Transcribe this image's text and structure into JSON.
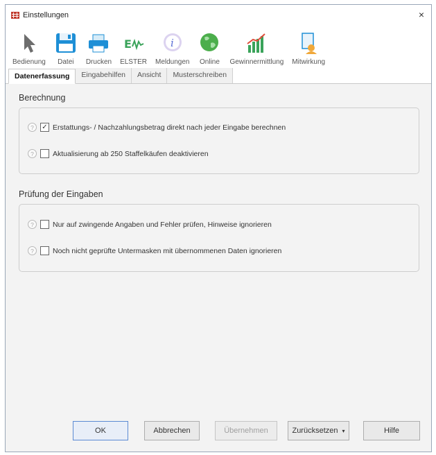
{
  "window": {
    "title": "Einstellungen",
    "close_glyph": "×"
  },
  "toolbar": [
    {
      "label": "Bedienung",
      "icon": "cursor-icon"
    },
    {
      "label": "Datei",
      "icon": "save-icon"
    },
    {
      "label": "Drucken",
      "icon": "printer-icon"
    },
    {
      "label": "ELSTER",
      "icon": "elster-icon"
    },
    {
      "label": "Meldungen",
      "icon": "info-icon"
    },
    {
      "label": "Online",
      "icon": "globe-icon"
    },
    {
      "label": "Gewinnermittlung",
      "icon": "chart-icon"
    },
    {
      "label": "Mitwirkung",
      "icon": "user-document-icon"
    }
  ],
  "tabs": [
    "Datenerfassung",
    "Eingabehilfen",
    "Ansicht",
    "Musterschreiben"
  ],
  "active_tab": "Datenerfassung",
  "sections": [
    {
      "title": "Berechnung",
      "options": [
        {
          "label": "Erstattungs- / Nachzahlungsbetrag direkt nach jeder Eingabe berechnen",
          "checked": true
        },
        {
          "label": "Aktualisierung ab 250 Staffelkäufen deaktivieren",
          "checked": false
        }
      ]
    },
    {
      "title": "Prüfung der Eingaben",
      "options": [
        {
          "label": "Nur auf zwingende Angaben und Fehler prüfen, Hinweise ignorieren",
          "checked": false
        },
        {
          "label": "Noch nicht geprüfte Untermasken mit übernommenen Daten ignorieren",
          "checked": false
        }
      ]
    }
  ],
  "help_glyph": "?",
  "check_glyph": "✓",
  "buttons": {
    "ok": "OK",
    "cancel": "Abbrechen",
    "apply": "Übernehmen",
    "reset": "Zurücksetzen",
    "reset_caret": "▾",
    "help": "Hilfe"
  },
  "colors": {
    "accent": "#1e8fd6",
    "window_bg": "#f3f3f3",
    "border": "#cdcdcd"
  }
}
